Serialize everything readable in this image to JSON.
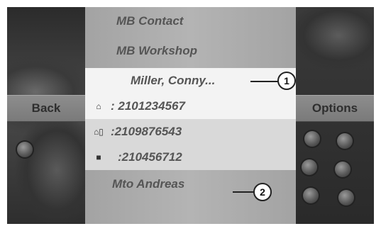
{
  "nav": {
    "back_label": "Back",
    "options_label": "Options"
  },
  "list": {
    "items": [
      {
        "label": "MB Contact"
      },
      {
        "label": "MB Workshop"
      },
      {
        "label": "Miller, Conny..."
      },
      {
        "label": ": 2101234567",
        "icon": "home-phone-icon"
      },
      {
        "label": ":2109876543",
        "icon": "home-mobile-icon"
      },
      {
        "label": ":210456712",
        "icon": "office-phone-icon"
      },
      {
        "label": "Mto Andreas"
      }
    ]
  },
  "callouts": [
    "1",
    "2"
  ],
  "colors": {
    "highlight": "#f3f3f3",
    "menu_bg": "#b0b0b0",
    "text": "#555555"
  }
}
